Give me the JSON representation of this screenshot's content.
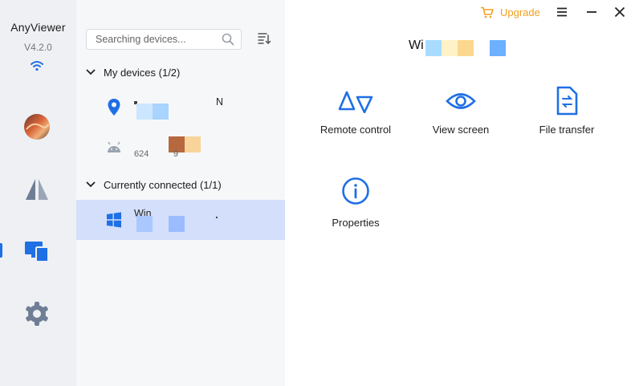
{
  "app": {
    "name": "AnyViewer",
    "version": "V4.2.0"
  },
  "rail": {
    "items": [
      "avatar",
      "remote-desktop",
      "devices",
      "settings"
    ],
    "active": "devices"
  },
  "panel": {
    "search_placeholder": "Searching devices...",
    "groups": [
      {
        "label": "My devices (1/2)"
      },
      {
        "label": "Currently connected (1/1)"
      }
    ],
    "devices": [
      {
        "name": "N",
        "sub": "",
        "icon": "location-pin-icon"
      },
      {
        "name": "",
        "sub": "624          9",
        "icon": "android-icon"
      },
      {
        "name": "Win",
        "sub": "",
        "icon": "windows-icon",
        "selected": true
      }
    ]
  },
  "header": {
    "upgrade": "Upgrade"
  },
  "main": {
    "device_title": "Wi",
    "actions": [
      {
        "label": "Remote control"
      },
      {
        "label": "View screen"
      },
      {
        "label": "File transfer"
      },
      {
        "label": "Properties"
      }
    ]
  },
  "colors": {
    "accent": "#1f6fe5",
    "upgrade": "#f0a020",
    "rail_bg": "#eef0f4",
    "panel_bg": "#f6f7f9",
    "selected_bg": "#d3dffb"
  }
}
